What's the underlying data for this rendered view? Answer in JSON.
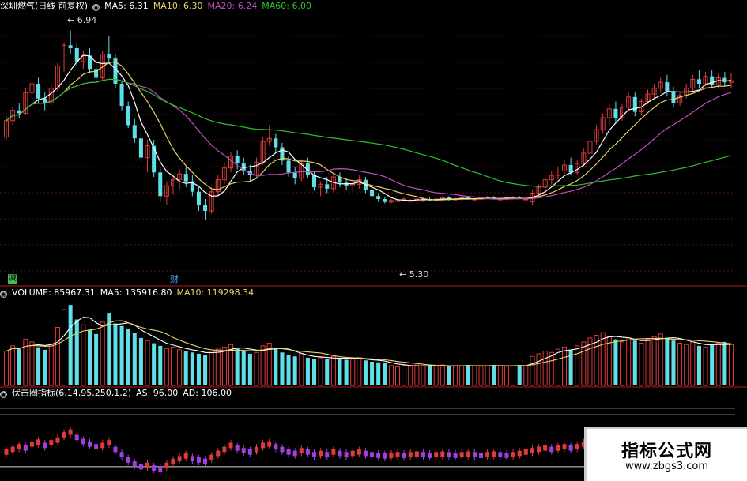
{
  "headers": {
    "price": {
      "name": "深圳燃气(日线 前复权)",
      "items": [
        {
          "text": "MA5: 6.31",
          "color": "#ffffff"
        },
        {
          "text": "MA10: 6.30",
          "color": "#e8d36a"
        },
        {
          "text": "MA20: 6.24",
          "color": "#c050c0"
        },
        {
          "text": "MA60: 6.00",
          "color": "#30c030"
        }
      ]
    },
    "volume": {
      "items": [
        {
          "text": "VOLUME: 85967.31",
          "color": "#ffffff"
        },
        {
          "text": "MA5: 135916.80",
          "color": "#ffffff"
        },
        {
          "text": "MA10: 119298.34",
          "color": "#e8d36a"
        }
      ]
    },
    "indicator": {
      "items": [
        {
          "text": "伏击圈指标(6,14,95,250,1,2)",
          "color": "#ffffff"
        },
        {
          "text": "AS: 96.00",
          "color": "#ffffff"
        },
        {
          "text": "AD: 106.00",
          "color": "#ffffff"
        }
      ]
    }
  },
  "annotations": {
    "high_label": "6.94",
    "low_label": "5.30",
    "marker_jian": "减",
    "marker_cai": "财"
  },
  "watermark": {
    "title": "指标公式网",
    "url": "www.zbgs3.com"
  },
  "colors": {
    "background": "#000000",
    "up": "#e03b3b",
    "down": "#5fe0e8",
    "ma5": "#ffffff",
    "ma10": "#e8d36a",
    "ma20": "#c050c0",
    "ma60": "#30c030",
    "indicator_up": "#e03b3b",
    "indicator_down": "#a040e0",
    "separator": "#b01818"
  },
  "chart_data": {
    "type": "candlestick",
    "price_range": [
      5.25,
      7.05
    ],
    "candles": [
      [
        6.22,
        6.36,
        6.2,
        6.33
      ],
      [
        6.33,
        6.42,
        6.3,
        6.4
      ],
      [
        6.4,
        6.45,
        6.35,
        6.38
      ],
      [
        6.38,
        6.55,
        6.37,
        6.52
      ],
      [
        6.52,
        6.6,
        6.48,
        6.58
      ],
      [
        6.58,
        6.62,
        6.45,
        6.48
      ],
      [
        6.48,
        6.52,
        6.4,
        6.45
      ],
      [
        6.45,
        6.58,
        6.43,
        6.55
      ],
      [
        6.55,
        6.72,
        6.53,
        6.7
      ],
      [
        6.7,
        6.86,
        6.66,
        6.84
      ],
      [
        6.84,
        6.94,
        6.78,
        6.82
      ],
      [
        6.82,
        6.86,
        6.7,
        6.73
      ],
      [
        6.73,
        6.8,
        6.68,
        6.77
      ],
      [
        6.77,
        6.82,
        6.65,
        6.68
      ],
      [
        6.68,
        6.72,
        6.6,
        6.62
      ],
      [
        6.62,
        6.8,
        6.6,
        6.78
      ],
      [
        6.78,
        6.9,
        6.72,
        6.75
      ],
      [
        6.75,
        6.78,
        6.55,
        6.58
      ],
      [
        6.58,
        6.6,
        6.4,
        6.43
      ],
      [
        6.43,
        6.46,
        6.28,
        6.3
      ],
      [
        6.3,
        6.34,
        6.18,
        6.21
      ],
      [
        6.21,
        6.24,
        6.05,
        6.08
      ],
      [
        6.08,
        6.2,
        5.98,
        6.16
      ],
      [
        6.16,
        6.2,
        5.95,
        5.98
      ],
      [
        5.98,
        6.02,
        5.78,
        5.82
      ],
      [
        5.82,
        5.92,
        5.76,
        5.89
      ],
      [
        5.89,
        5.96,
        5.83,
        5.93
      ],
      [
        5.93,
        6.0,
        5.86,
        5.97
      ],
      [
        5.97,
        6.02,
        5.88,
        5.92
      ],
      [
        5.92,
        5.96,
        5.82,
        5.85
      ],
      [
        5.85,
        5.88,
        5.72,
        5.76
      ],
      [
        5.76,
        5.8,
        5.66,
        5.72
      ],
      [
        5.72,
        5.88,
        5.7,
        5.85
      ],
      [
        5.85,
        5.96,
        5.82,
        5.93
      ],
      [
        5.93,
        6.05,
        5.9,
        6.01
      ],
      [
        6.01,
        6.12,
        5.98,
        6.09
      ],
      [
        6.09,
        6.13,
        6.0,
        6.04
      ],
      [
        6.04,
        6.08,
        5.96,
        5.99
      ],
      [
        5.99,
        6.03,
        5.92,
        5.96
      ],
      [
        5.96,
        6.08,
        5.94,
        6.05
      ],
      [
        6.05,
        6.22,
        6.03,
        6.19
      ],
      [
        6.19,
        6.3,
        6.16,
        6.21
      ],
      [
        6.21,
        6.24,
        6.12,
        6.15
      ],
      [
        6.15,
        6.18,
        6.03,
        6.06
      ],
      [
        6.06,
        6.09,
        5.95,
        5.98
      ],
      [
        5.98,
        6.02,
        5.9,
        5.94
      ],
      [
        5.94,
        6.07,
        5.92,
        6.04
      ],
      [
        6.04,
        6.08,
        5.94,
        5.96
      ],
      [
        5.96,
        5.99,
        5.86,
        5.88
      ],
      [
        5.88,
        5.92,
        5.82,
        5.9
      ],
      [
        5.9,
        5.95,
        5.84,
        5.87
      ],
      [
        5.87,
        5.98,
        5.85,
        5.95
      ],
      [
        5.95,
        5.98,
        5.88,
        5.91
      ],
      [
        5.91,
        5.94,
        5.86,
        5.89
      ],
      [
        5.89,
        5.93,
        5.85,
        5.9
      ],
      [
        5.9,
        5.96,
        5.87,
        5.93
      ],
      [
        5.93,
        5.95,
        5.84,
        5.86
      ],
      [
        5.86,
        5.88,
        5.8,
        5.82
      ],
      [
        5.82,
        5.84,
        5.78,
        5.8
      ],
      [
        5.8,
        5.81,
        5.77,
        5.78
      ],
      [
        5.78,
        5.8,
        5.77,
        5.79
      ],
      [
        5.79,
        5.8,
        5.78,
        5.79
      ],
      [
        5.8,
        5.81,
        5.79,
        5.8
      ],
      [
        5.79,
        5.8,
        5.78,
        5.79
      ],
      [
        5.8,
        5.81,
        5.79,
        5.8
      ],
      [
        5.79,
        5.81,
        5.78,
        5.8
      ],
      [
        5.8,
        5.81,
        5.79,
        5.79
      ],
      [
        5.79,
        5.8,
        5.78,
        5.8
      ],
      [
        5.8,
        5.82,
        5.79,
        5.81
      ],
      [
        5.81,
        5.82,
        5.79,
        5.8
      ],
      [
        5.8,
        5.81,
        5.79,
        5.8
      ],
      [
        5.8,
        5.82,
        5.79,
        5.81
      ],
      [
        5.81,
        5.82,
        5.8,
        5.8
      ],
      [
        5.8,
        5.81,
        5.79,
        5.8
      ],
      [
        5.8,
        5.82,
        5.79,
        5.81
      ],
      [
        5.81,
        5.82,
        5.8,
        5.81
      ],
      [
        5.81,
        5.82,
        5.8,
        5.8
      ],
      [
        5.8,
        5.81,
        5.79,
        5.8
      ],
      [
        5.8,
        5.81,
        5.79,
        5.81
      ],
      [
        5.81,
        5.82,
        5.8,
        5.81
      ],
      [
        5.81,
        5.82,
        5.8,
        5.8
      ],
      [
        5.8,
        5.81,
        5.79,
        5.8
      ],
      [
        5.78,
        5.86,
        5.76,
        5.84
      ],
      [
        5.84,
        5.9,
        5.82,
        5.88
      ],
      [
        5.88,
        5.96,
        5.86,
        5.93
      ],
      [
        5.93,
        5.99,
        5.9,
        5.96
      ],
      [
        5.96,
        6.02,
        5.93,
        5.99
      ],
      [
        5.99,
        6.06,
        5.97,
        6.03
      ],
      [
        6.03,
        6.08,
        5.96,
        5.98
      ],
      [
        5.98,
        6.06,
        5.96,
        6.04
      ],
      [
        6.04,
        6.14,
        6.02,
        6.11
      ],
      [
        6.11,
        6.22,
        6.09,
        6.19
      ],
      [
        6.19,
        6.3,
        6.17,
        6.27
      ],
      [
        6.27,
        6.38,
        6.24,
        6.35
      ],
      [
        6.35,
        6.44,
        6.3,
        6.41
      ],
      [
        6.41,
        6.46,
        6.32,
        6.35
      ],
      [
        6.35,
        6.44,
        6.33,
        6.42
      ],
      [
        6.42,
        6.52,
        6.4,
        6.49
      ],
      [
        6.49,
        6.52,
        6.36,
        6.39
      ],
      [
        6.39,
        6.48,
        6.37,
        6.46
      ],
      [
        6.46,
        6.54,
        6.44,
        6.51
      ],
      [
        6.51,
        6.58,
        6.48,
        6.55
      ],
      [
        6.55,
        6.62,
        6.52,
        6.59
      ],
      [
        6.59,
        6.64,
        6.5,
        6.53
      ],
      [
        6.53,
        6.56,
        6.42,
        6.45
      ],
      [
        6.45,
        6.52,
        6.43,
        6.5
      ],
      [
        6.5,
        6.58,
        6.48,
        6.55
      ],
      [
        6.55,
        6.64,
        6.53,
        6.61
      ],
      [
        6.61,
        6.67,
        6.55,
        6.58
      ],
      [
        6.58,
        6.66,
        6.56,
        6.63
      ],
      [
        6.63,
        6.67,
        6.55,
        6.57
      ],
      [
        6.57,
        6.65,
        6.55,
        6.62
      ],
      [
        6.62,
        6.66,
        6.56,
        6.59
      ],
      [
        6.59,
        6.65,
        6.55,
        6.6
      ]
    ],
    "volume": [
      52,
      60,
      55,
      70,
      66,
      58,
      54,
      62,
      88,
      115,
      122,
      100,
      92,
      84,
      78,
      96,
      110,
      94,
      90,
      85,
      80,
      72,
      68,
      64,
      60,
      56,
      58,
      54,
      52,
      50,
      48,
      46,
      52,
      55,
      58,
      62,
      56,
      52,
      48,
      50,
      60,
      64,
      56,
      50,
      46,
      44,
      48,
      42,
      40,
      42,
      40,
      44,
      41,
      39,
      40,
      42,
      38,
      36,
      35,
      34,
      30,
      28,
      30,
      29,
      31,
      30,
      29,
      30,
      31,
      30,
      29,
      30,
      31,
      30,
      29,
      30,
      31,
      30,
      29,
      30,
      31,
      30,
      44,
      48,
      52,
      50,
      55,
      58,
      54,
      60,
      66,
      72,
      76,
      80,
      74,
      70,
      66,
      72,
      68,
      64,
      70,
      74,
      78,
      72,
      68,
      64,
      62,
      66,
      60,
      58,
      62,
      64,
      66,
      62
    ],
    "indicator": [
      40,
      44,
      48,
      46,
      52,
      55,
      50,
      54,
      58,
      66,
      70,
      62,
      56,
      52,
      48,
      50,
      54,
      44,
      36,
      28,
      22,
      18,
      20,
      16,
      14,
      20,
      26,
      30,
      34,
      30,
      28,
      26,
      32,
      38,
      44,
      50,
      46,
      42,
      40,
      44,
      50,
      52,
      48,
      44,
      40,
      38,
      42,
      40,
      36,
      38,
      36,
      40,
      38,
      36,
      38,
      40,
      38,
      36,
      35,
      34,
      35,
      36,
      35,
      36,
      37,
      36,
      35,
      36,
      37,
      36,
      35,
      36,
      37,
      36,
      35,
      36,
      37,
      36,
      35,
      36,
      38,
      40,
      42,
      44,
      46,
      44,
      46,
      48,
      46,
      48,
      52,
      56,
      50,
      48,
      46,
      44,
      46,
      48,
      46,
      44,
      46,
      48,
      52,
      50,
      48,
      46,
      44,
      46,
      44,
      42,
      44,
      46,
      48,
      46
    ],
    "indicator_lines": {
      "AS": 96,
      "AD": 106
    }
  }
}
